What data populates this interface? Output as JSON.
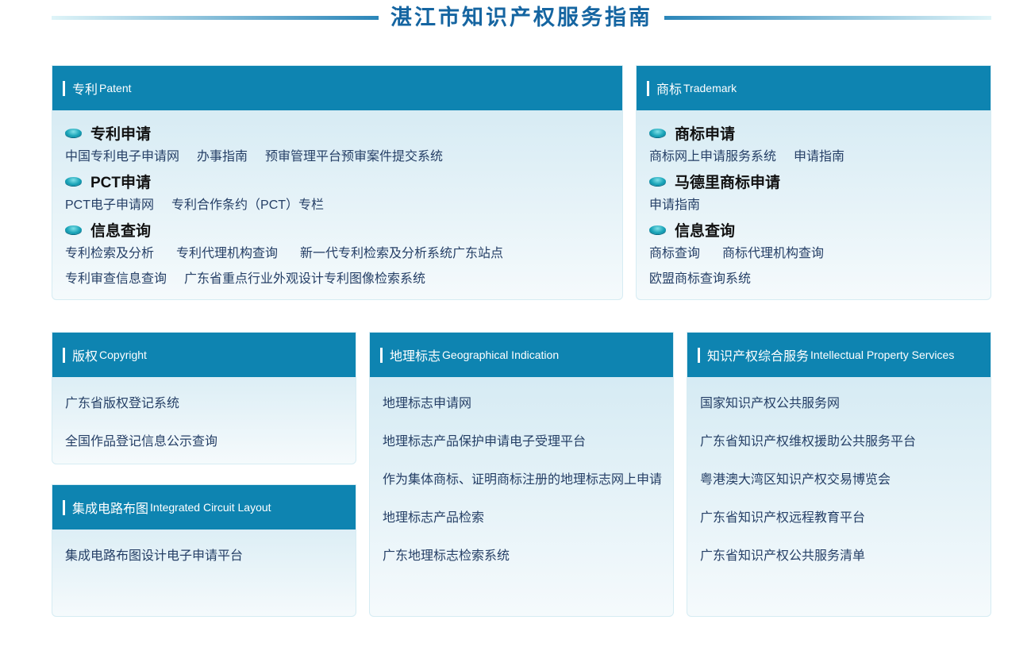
{
  "page_title": "湛江市知识产权服务指南",
  "patent": {
    "head_cn": "专利",
    "head_en": "Patent",
    "sections": [
      {
        "title": "专利申请",
        "rows": [
          [
            "中国专利电子申请网",
            "办事指南",
            "预审管理平台预审案件提交系统"
          ]
        ]
      },
      {
        "title": "PCT申请",
        "rows": [
          [
            "PCT电子申请网",
            "专利合作条约（PCT）专栏"
          ]
        ]
      },
      {
        "title": "信息查询",
        "rows": [
          [
            "专利检索及分析",
            "专利代理机构查询",
            "新一代专利检索及分析系统广东站点"
          ],
          [
            "专利审查信息查询",
            "广东省重点行业外观设计专利图像检索系统"
          ]
        ]
      }
    ]
  },
  "trademark": {
    "head_cn": "商标",
    "head_en": "Trademark",
    "sections": [
      {
        "title": "商标申请",
        "rows": [
          [
            "商标网上申请服务系统",
            "申请指南"
          ]
        ]
      },
      {
        "title": "马德里商标申请",
        "rows": [
          [
            "申请指南"
          ]
        ]
      },
      {
        "title": "信息查询",
        "rows": [
          [
            "商标查询",
            "商标代理机构查询"
          ],
          [
            "欧盟商标查询系统"
          ]
        ]
      }
    ]
  },
  "copyright": {
    "head_cn": "版权",
    "head_en": "Copyright",
    "items": [
      "广东省版权登记系统",
      "全国作品登记信息公示查询"
    ]
  },
  "ic": {
    "head_cn": "集成电路布图",
    "head_en": "Integrated Circuit Layout",
    "items": [
      "集成电路布图设计电子申请平台"
    ]
  },
  "geo": {
    "head_cn": "地理标志",
    "head_en": "Geographical Indication",
    "items": [
      "地理标志申请网",
      "地理标志产品保护申请电子受理平台",
      "作为集体商标、证明商标注册的地理标志网上申请",
      "地理标志产品检索",
      "广东地理标志检索系统"
    ]
  },
  "ips": {
    "head_cn": "知识产权综合服务",
    "head_en": "Intellectual Property Services",
    "items": [
      "国家知识产权公共服务网",
      "广东省知识产权维权援助公共服务平台",
      "粤港澳大湾区知识产权交易博览会",
      "广东省知识产权远程教育平台",
      "广东省知识产权公共服务清单"
    ]
  }
}
